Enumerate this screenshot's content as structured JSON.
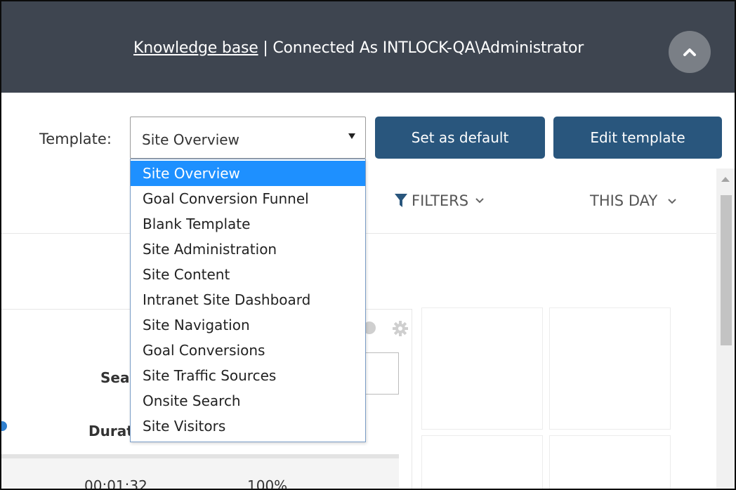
{
  "header": {
    "knowledge_base_link": "Knowledge base",
    "connection_text": " | Connected As INTLOCK-QA\\Administrator"
  },
  "template_bar": {
    "label": "Template:",
    "selected": "Site Overview",
    "set_default_label": "Set as default",
    "edit_label": "Edit template",
    "options": [
      "Site Overview",
      "Goal Conversion Funnel",
      "Blank Template",
      "Site Administration",
      "Site Content",
      "Intranet Site Dashboard",
      "Site Navigation",
      "Goal Conversions",
      "Site Traffic Sources",
      "Onsite Search",
      "Site Visitors"
    ]
  },
  "toolbar": {
    "filters_label": "FILTERS",
    "period_label": "THIS DAY"
  },
  "panel": {
    "search_label": "Sea",
    "duration_label": "Durat",
    "row": {
      "duration": "00:01:32",
      "percent": "100%"
    }
  },
  "colors": {
    "header_bg": "#3e4550",
    "button_bg": "#29567d",
    "selected_option_bg": "#1e90ff"
  }
}
